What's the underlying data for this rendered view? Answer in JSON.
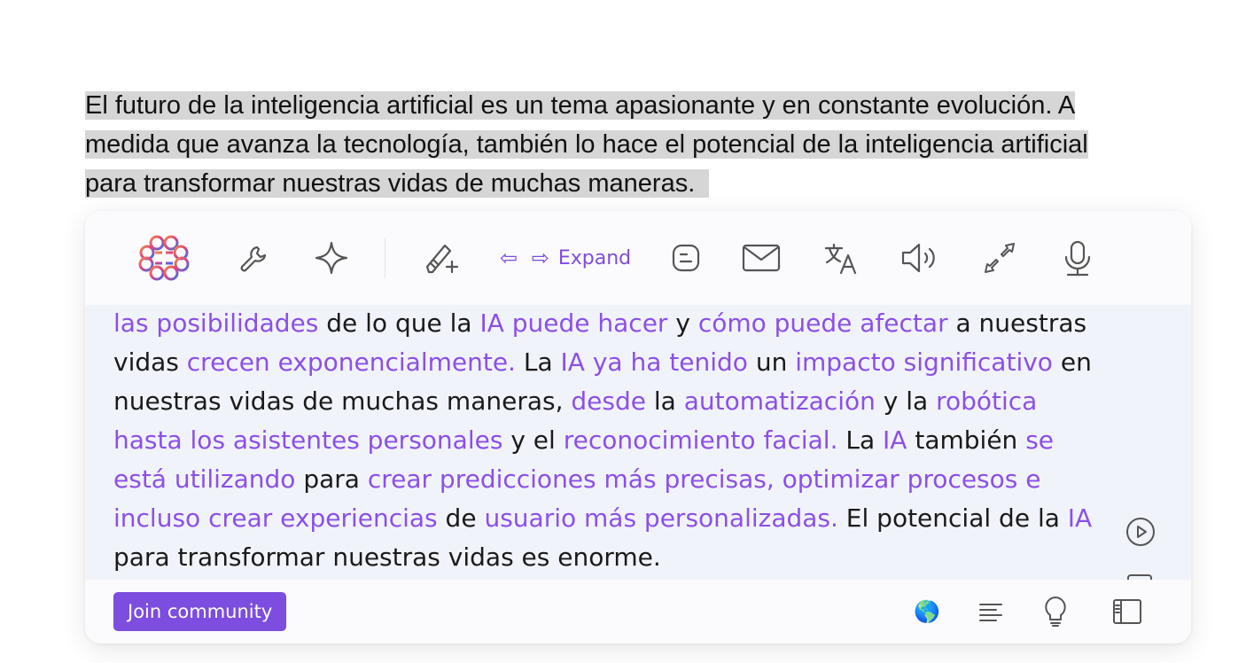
{
  "selected_paragraph": {
    "lines": [
      "El futuro de la inteligencia artificial es un tema apasionante y en constante evolución. A",
      "medida que avanza la tecnología, también lo hace el potencial de la inteligencia artificial",
      "para transformar nuestras vidas de muchas maneras.  "
    ]
  },
  "toolbar": {
    "logo_icon": "brain-logo-icon",
    "items": [
      {
        "name": "wrench-icon"
      },
      {
        "name": "sparkle-icon"
      },
      {
        "name": "magic-pen-icon"
      },
      {
        "name": "blogger-icon"
      },
      {
        "name": "mail-icon"
      },
      {
        "name": "translate-icon"
      },
      {
        "name": "speaker-icon"
      },
      {
        "name": "collapse-arrows-icon"
      },
      {
        "name": "microphone-icon"
      }
    ],
    "expand_arrows": "⇦ ⇨",
    "expand_label": "Expand"
  },
  "content": {
    "segments": [
      {
        "t": "las posibilidades",
        "hl": true
      },
      {
        "t": " de lo que la ",
        "hl": false
      },
      {
        "t": "IA puede hacer",
        "hl": true
      },
      {
        "t": " y ",
        "hl": false
      },
      {
        "t": "cómo puede afectar",
        "hl": true
      },
      {
        "t": " a nuestras vidas ",
        "hl": false
      },
      {
        "t": "crecen exponencialmente.",
        "hl": true
      },
      {
        "t": " La ",
        "hl": false
      },
      {
        "t": "IA ya ha tenido",
        "hl": true
      },
      {
        "t": " un ",
        "hl": false
      },
      {
        "t": "impacto significativo",
        "hl": true
      },
      {
        "t": " en nuestras vidas de muchas maneras, ",
        "hl": false
      },
      {
        "t": "desde",
        "hl": true
      },
      {
        "t": " la ",
        "hl": false
      },
      {
        "t": "automatización",
        "hl": true
      },
      {
        "t": " y la ",
        "hl": false
      },
      {
        "t": "robótica hasta los asistentes personales",
        "hl": true
      },
      {
        "t": " y el ",
        "hl": false
      },
      {
        "t": "reconocimiento facial.",
        "hl": true
      },
      {
        "t": " La ",
        "hl": false
      },
      {
        "t": "IA",
        "hl": true
      },
      {
        "t": " también ",
        "hl": false
      },
      {
        "t": "se está utilizando",
        "hl": true
      },
      {
        "t": " para ",
        "hl": false
      },
      {
        "t": "crear predicciones más precisas, optimizar procesos e incluso crear experiencias",
        "hl": true
      },
      {
        "t": " de ",
        "hl": false
      },
      {
        "t": "usuario más personalizadas.",
        "hl": true
      },
      {
        "t": " El potencial de la ",
        "hl": false
      },
      {
        "t": "IA",
        "hl": true
      },
      {
        "t": " para transformar nuestras vidas es enorme.",
        "hl": false
      }
    ],
    "play_icon": "play-icon"
  },
  "footer": {
    "join_label": "Join community",
    "icons": [
      "globe-icon",
      "align-text-icon",
      "lightbulb-icon",
      "sidebar-icon"
    ],
    "globe_glyph": "🌎"
  },
  "colors": {
    "accent": "#7c4ddf",
    "highlight_text": "#8b50e8",
    "selection": "#d6d6d6",
    "content_bg": "#f1f3fb"
  }
}
